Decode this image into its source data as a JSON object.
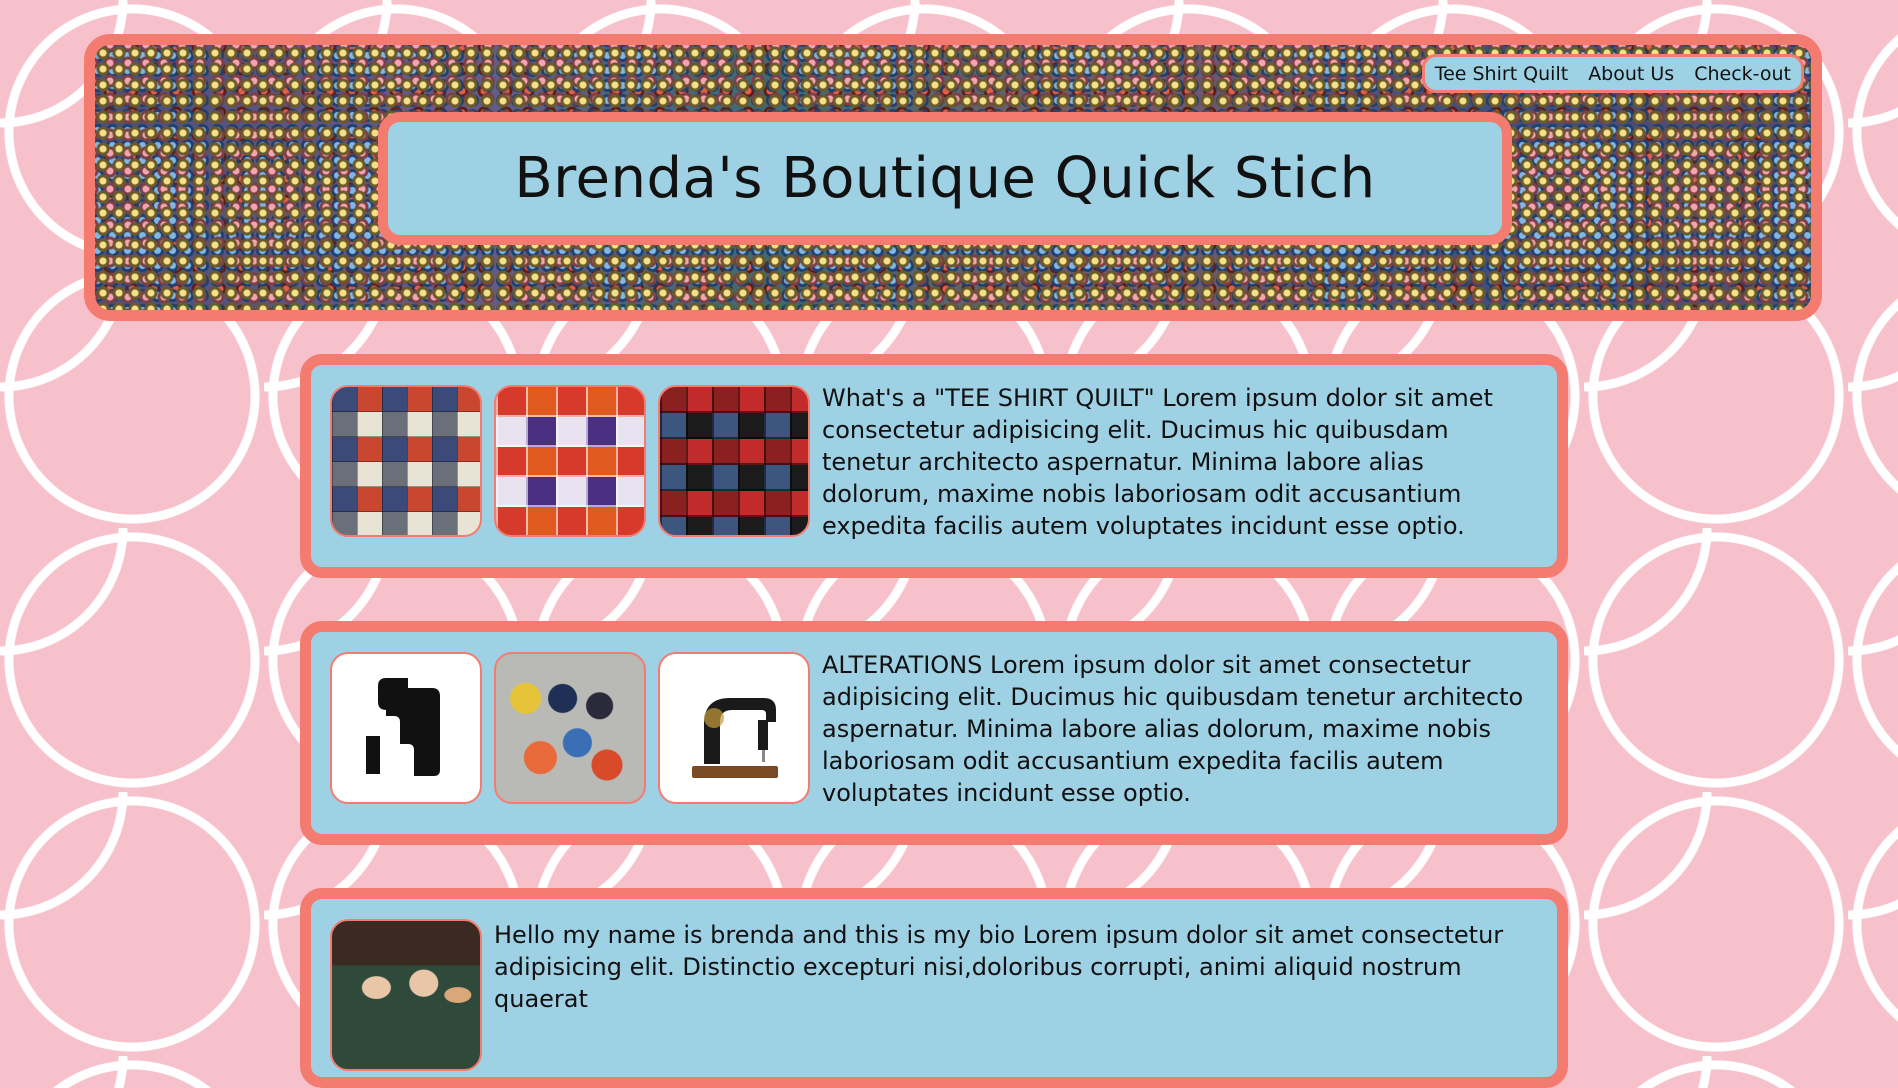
{
  "site": {
    "title": "Brenda's Boutique Quick Stich"
  },
  "nav": {
    "items": [
      {
        "label": "Tee Shirt Quilt"
      },
      {
        "label": "About Us"
      },
      {
        "label": "Check-out"
      }
    ]
  },
  "sections": [
    {
      "text": "What's a \"TEE SHIRT QUILT\" Lorem ipsum dolor sit amet consectetur adipisicing elit. Ducimus hic quibusdam tenetur architecto aspernatur. Minima labore alias dolorum, maxime nobis laboriosam odit accusantium expedita facilis autem voluptates incidunt esse optio."
    },
    {
      "text": "ALTERATIONS Lorem ipsum dolor sit amet consectetur adipisicing elit. Ducimus hic quibusdam tenetur architecto aspernatur. Minima labore alias dolorum, maxime nobis laboriosam odit accusantium expedita facilis autem voluptates incidunt esse optio."
    },
    {
      "text": "Hello my name is brenda and this is my bio Lorem ipsum dolor sit amet consectetur adipisicing elit. Distinctio excepturi nisi,doloribus corrupti, animi aliquid nostrum quaerat"
    }
  ],
  "colors": {
    "accent": "#f47b70",
    "panel": "#9fd1e4",
    "background": "#f7c1cc"
  }
}
